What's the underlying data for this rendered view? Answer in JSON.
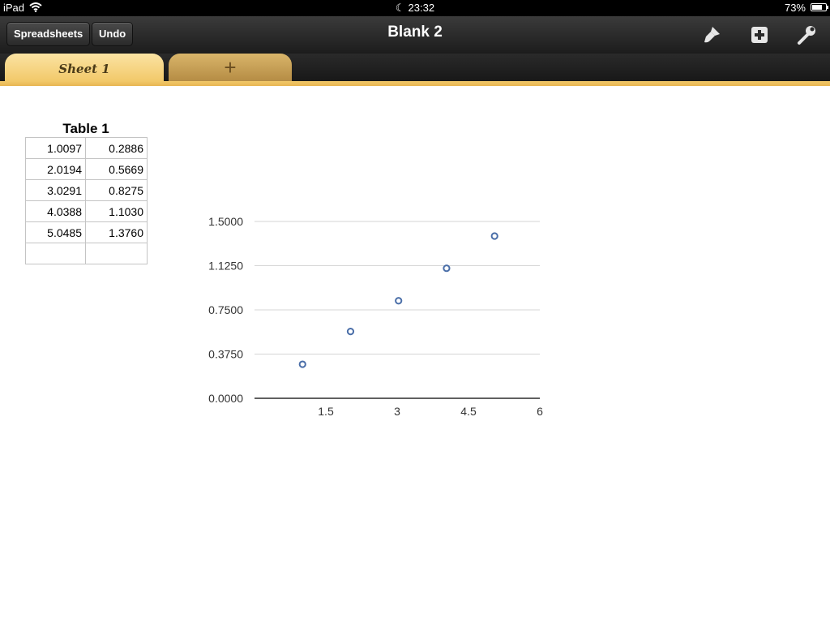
{
  "status_bar": {
    "carrier": "iPad",
    "time": "23:32",
    "battery": "73%"
  },
  "toolbar": {
    "spreadsheets_label": "Spreadsheets",
    "undo_label": "Undo",
    "title": "Blank 2",
    "icons": [
      "paintbrush-icon",
      "add-icon",
      "wrench-icon"
    ]
  },
  "tabs": {
    "active_label": "Sheet 1",
    "add_label": "+"
  },
  "table": {
    "title": "Table 1",
    "rows": [
      [
        "1.0097",
        "0.2886"
      ],
      [
        "2.0194",
        "0.5669"
      ],
      [
        "3.0291",
        "0.8275"
      ],
      [
        "4.0388",
        "1.1030"
      ],
      [
        "5.0485",
        "1.3760"
      ],
      [
        "",
        ""
      ]
    ]
  },
  "chart_data": {
    "type": "scatter",
    "x": [
      1.0097,
      2.0194,
      3.0291,
      4.0388,
      5.0485
    ],
    "y": [
      0.2886,
      0.5669,
      0.8275,
      1.103,
      1.376
    ],
    "xlim": [
      0,
      6
    ],
    "ylim": [
      0,
      1.5
    ],
    "x_ticks": [
      "1.5",
      "3",
      "4.5",
      "6"
    ],
    "x_tick_values": [
      1.5,
      3,
      4.5,
      6
    ],
    "y_ticks": [
      "0.0000",
      "0.3750",
      "0.7500",
      "1.1250",
      "1.5000"
    ],
    "y_tick_values": [
      0,
      0.375,
      0.75,
      1.125,
      1.5
    ],
    "grid": true,
    "marker_color": "#4a6ea8"
  }
}
